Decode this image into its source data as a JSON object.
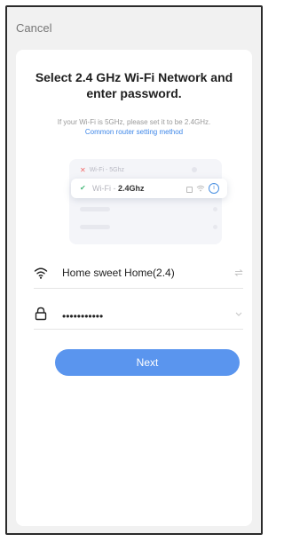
{
  "topbar": {
    "cancel_label": "Cancel"
  },
  "header": {
    "title": "Select 2.4 GHz Wi-Fi Network and enter password.",
    "hint": "If your Wi-Fi is 5GHz, please set it to be 2.4GHz.",
    "link": "Common router setting method"
  },
  "illustration": {
    "row_5g": "Wi-Fi - 5Ghz",
    "row_24g_prefix": "Wi-Fi - ",
    "row_24g_band": "2.4Ghz",
    "info_glyph": "i"
  },
  "form": {
    "network_name": "Home sweet Home(2.4)",
    "password_mask": "•••••••••••",
    "icons": [
      "wifi-icon",
      "switch-network-icon",
      "lock-icon",
      "chevron-down-icon"
    ]
  },
  "actions": {
    "next_label": "Next"
  },
  "colors": {
    "accent": "#5A95EE",
    "link": "#3D86E8",
    "check": "#48B97A",
    "cross": "#F26A6A"
  }
}
